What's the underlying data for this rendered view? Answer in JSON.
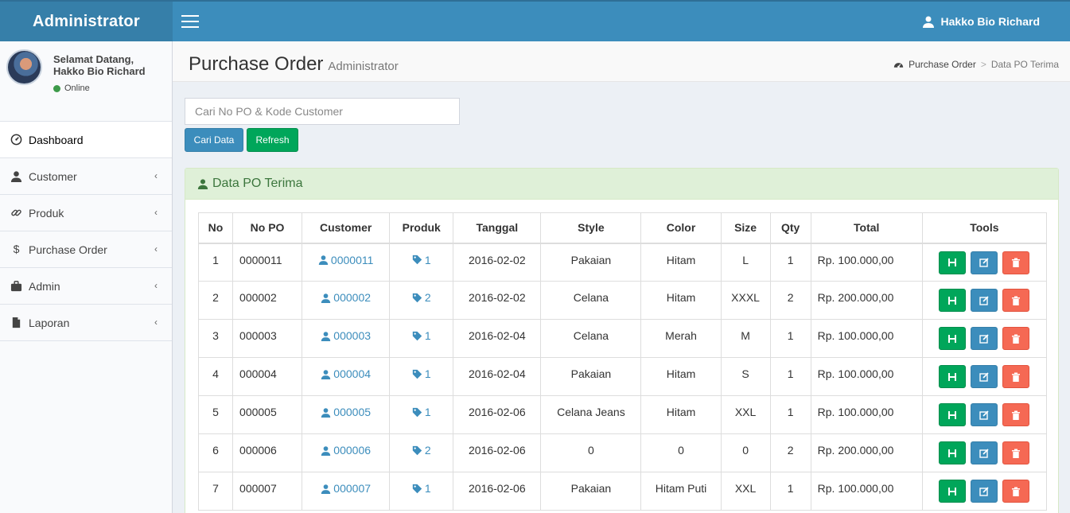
{
  "header": {
    "logo": "Administrator",
    "user_name": "Hakko Bio Richard"
  },
  "sidebar": {
    "welcome_line1": "Selamat Datang,",
    "welcome_line2": "Hakko Bio Richard",
    "status": "Online",
    "status_color": "#3d9a4a",
    "items": [
      {
        "label": "Dashboard",
        "icon": "dashboard-icon",
        "has_chevron": false
      },
      {
        "label": "Customer",
        "icon": "user-icon",
        "has_chevron": true
      },
      {
        "label": "Produk",
        "icon": "link-icon",
        "has_chevron": true
      },
      {
        "label": "Purchase Order",
        "icon": "dollar-icon",
        "has_chevron": true
      },
      {
        "label": "Admin",
        "icon": "briefcase-icon",
        "has_chevron": true
      },
      {
        "label": "Laporan",
        "icon": "file-icon",
        "has_chevron": true
      }
    ]
  },
  "page": {
    "title": "Purchase Order",
    "subtitle": "Administrator",
    "breadcrumb": [
      "Purchase Order",
      "Data PO Terima"
    ]
  },
  "search": {
    "placeholder": "Cari No PO & Kode Customer",
    "value": "",
    "search_button": "Cari Data",
    "refresh_button": "Refresh"
  },
  "box": {
    "title": "Data PO Terima",
    "header_color": "#dff0d8"
  },
  "table": {
    "columns": [
      "No",
      "No PO",
      "Customer",
      "Produk",
      "Tanggal",
      "Style",
      "Color",
      "Size",
      "Qty",
      "Total",
      "Tools"
    ],
    "rows": [
      {
        "no": "1",
        "no_po": "0000011",
        "customer": "0000011",
        "produk": "1",
        "tanggal": "2016-02-02",
        "style": "Pakaian",
        "color": "Hitam",
        "size": "L",
        "qty": "1",
        "total": "Rp. 100.000,00"
      },
      {
        "no": "2",
        "no_po": "000002",
        "customer": "000002",
        "produk": "2",
        "tanggal": "2016-02-02",
        "style": "Celana",
        "color": "Hitam",
        "size": "XXXL",
        "qty": "2",
        "total": "Rp. 200.000,00"
      },
      {
        "no": "3",
        "no_po": "000003",
        "customer": "000003",
        "produk": "1",
        "tanggal": "2016-02-04",
        "style": "Celana",
        "color": "Merah",
        "size": "M",
        "qty": "1",
        "total": "Rp. 100.000,00"
      },
      {
        "no": "4",
        "no_po": "000004",
        "customer": "000004",
        "produk": "1",
        "tanggal": "2016-02-04",
        "style": "Pakaian",
        "color": "Hitam",
        "size": "S",
        "qty": "1",
        "total": "Rp. 100.000,00"
      },
      {
        "no": "5",
        "no_po": "000005",
        "customer": "000005",
        "produk": "1",
        "tanggal": "2016-02-06",
        "style": "Celana Jeans",
        "color": "Hitam",
        "size": "XXL",
        "qty": "1",
        "total": "Rp. 100.000,00"
      },
      {
        "no": "6",
        "no_po": "000006",
        "customer": "000006",
        "produk": "2",
        "tanggal": "2016-02-06",
        "style": "0",
        "color": "0",
        "size": "0",
        "qty": "2",
        "total": "Rp. 200.000,00"
      },
      {
        "no": "7",
        "no_po": "000007",
        "customer": "000007",
        "produk": "1",
        "tanggal": "2016-02-06",
        "style": "Pakaian",
        "color": "Hitam Puti",
        "size": "XXL",
        "qty": "1",
        "total": "Rp. 100.000,00"
      }
    ],
    "tools": [
      "save-icon",
      "edit-icon",
      "trash-icon"
    ]
  },
  "colors": {
    "primary": "#3c8dbc",
    "success": "#00a65a",
    "danger": "#f56954"
  }
}
